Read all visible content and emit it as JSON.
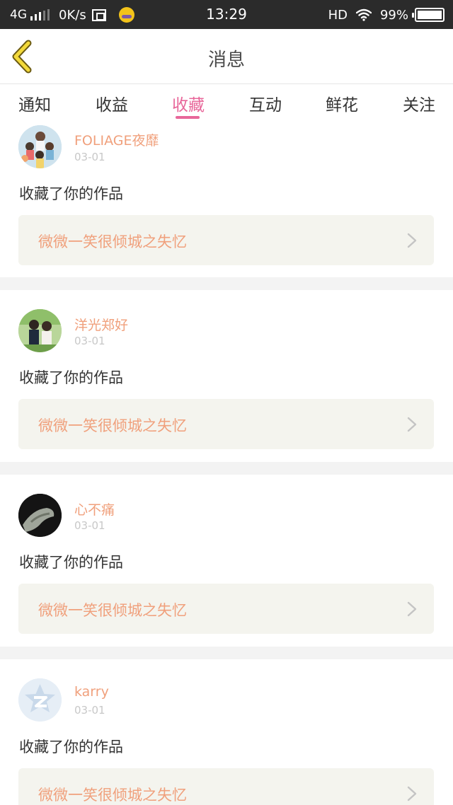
{
  "status_bar": {
    "network": "4G",
    "speed": "0K/s",
    "time": "13:29",
    "hd": "HD",
    "battery": "99%",
    "battery_level": 0.99
  },
  "header": {
    "title": "消息"
  },
  "tabs": [
    {
      "label": "通知"
    },
    {
      "label": "收益"
    },
    {
      "label": "收藏",
      "active": true
    },
    {
      "label": "互动"
    },
    {
      "label": "鲜花"
    },
    {
      "label": "关注"
    }
  ],
  "messages": [
    {
      "user": "FOLIAGE夜靡",
      "date": "03-01",
      "action": "收藏了你的作品",
      "work": "微微一笑很倾城之失忆"
    },
    {
      "user": "洋光郑好",
      "date": "03-01",
      "action": "收藏了你的作品",
      "work": "微微一笑很倾城之失忆"
    },
    {
      "user": "心不痛",
      "date": "03-01",
      "action": "收藏了你的作品",
      "work": "微微一笑很倾城之失忆"
    },
    {
      "user": "karry",
      "date": "03-01",
      "action": "收藏了你的作品",
      "work": "微微一笑很倾城之失忆"
    }
  ],
  "colors": {
    "accent": "#e8679a",
    "username": "#f0a07c",
    "card_bg": "#f4f4ee",
    "back_arrow": "#f3c31a"
  }
}
